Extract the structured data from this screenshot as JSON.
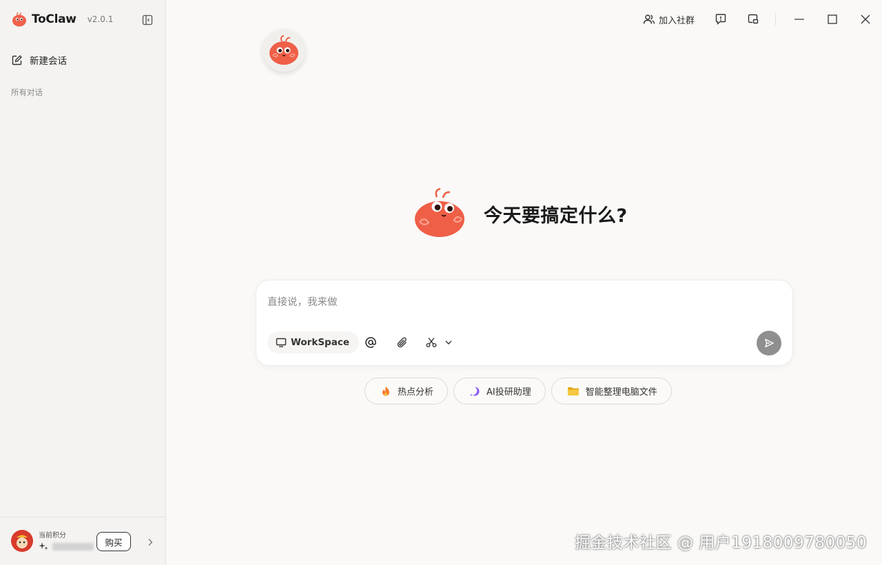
{
  "app": {
    "name": "ToClaw",
    "version": "v2.0.1"
  },
  "sidebar": {
    "new_chat_label": "新建会话",
    "section_title": "所有对话",
    "points_label": "当前积分",
    "buy_label": "购买"
  },
  "topbar": {
    "community_label": "加入社群"
  },
  "main": {
    "heading": "今天要搞定什么?",
    "composer": {
      "placeholder": "直接说，我来做",
      "workspace_label": "WorkSpace"
    },
    "suggestions": [
      {
        "label": "热点分析",
        "icon": "fire-icon"
      },
      {
        "label": "AI投研助理",
        "icon": "sparkle-chat-icon"
      },
      {
        "label": "智能整理电脑文件",
        "icon": "folder-icon"
      }
    ]
  },
  "watermark": "掘金技术社区 @ 用户1918009780050",
  "colors": {
    "brand": "#f0624c",
    "send_button": "#8f8f8f",
    "fire": "#f57a2e",
    "sparkle": "#8a5cf6",
    "folder": "#f2c230"
  }
}
